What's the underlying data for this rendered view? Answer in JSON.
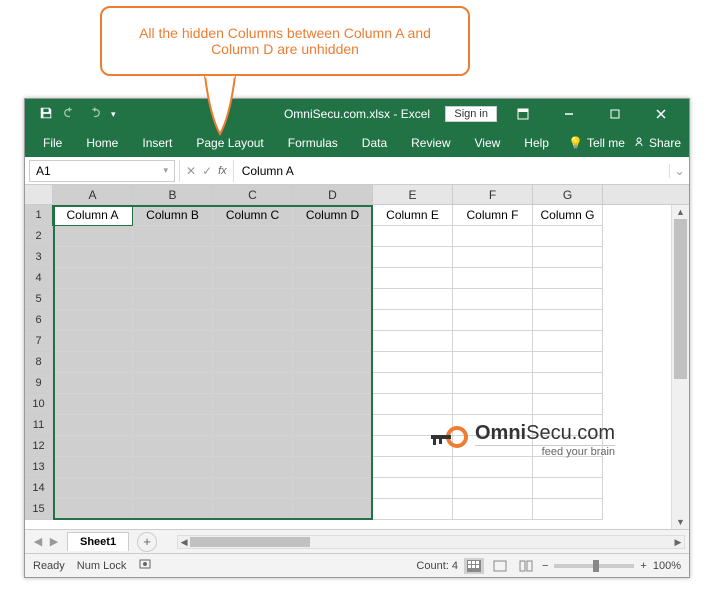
{
  "callout_text": "All the hidden Columns between Column A and Column D are unhidden",
  "title": {
    "filename": "OmniSecu.com.xlsx",
    "app": "Excel",
    "signin": "Sign in"
  },
  "ribbon_tabs": [
    "File",
    "Home",
    "Insert",
    "Page Layout",
    "Formulas",
    "Data",
    "Review",
    "View",
    "Help"
  ],
  "tellme": "Tell me",
  "share": "Share",
  "name_box": "A1",
  "formula_value": "Column A",
  "columns": [
    "A",
    "B",
    "C",
    "D",
    "E",
    "F",
    "G"
  ],
  "row_labels": [
    "1",
    "2",
    "3",
    "4",
    "5",
    "6",
    "7",
    "8",
    "9",
    "10",
    "11",
    "12",
    "13",
    "14",
    "15"
  ],
  "row1": [
    "Column A",
    "Column B",
    "Column  C",
    "Column D",
    "Column E",
    "Column F",
    "Column G"
  ],
  "selected_cols": [
    "A",
    "B",
    "C",
    "D"
  ],
  "sheet_name": "Sheet1",
  "status": {
    "ready": "Ready",
    "numlock": "Num Lock",
    "count": "Count: 4",
    "zoom": "100%"
  },
  "logo": {
    "brand_prefix": "Omni",
    "brand_suffix": "Secu",
    "tld": ".com",
    "tagline": "feed your brain"
  }
}
